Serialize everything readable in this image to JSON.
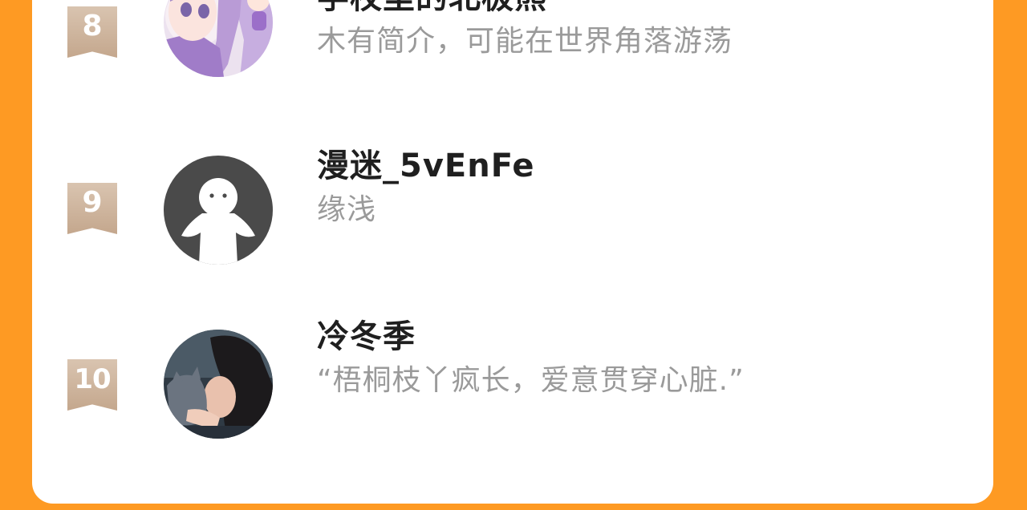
{
  "ranking": {
    "items": [
      {
        "rank": "8",
        "name": "学校里的北极熊",
        "bio": "木有简介，可能在世界角落游荡",
        "avatar_icon": "anime-girl-avatar"
      },
      {
        "rank": "9",
        "name": "漫迷_5vEnFe",
        "bio": "缘浅",
        "avatar_icon": "default-user-avatar"
      },
      {
        "rank": "10",
        "name": "冷冬季",
        "bio": "“梧桐枝丫疯长，爱意贯穿心脏.”",
        "avatar_icon": "girl-with-cat-avatar"
      }
    ]
  },
  "colors": {
    "background": "#fe9a23",
    "card": "#ffffff",
    "rank_badge": "#c4a78d",
    "name_text": "#1f1f1f",
    "bio_text": "#9a9a9a"
  }
}
